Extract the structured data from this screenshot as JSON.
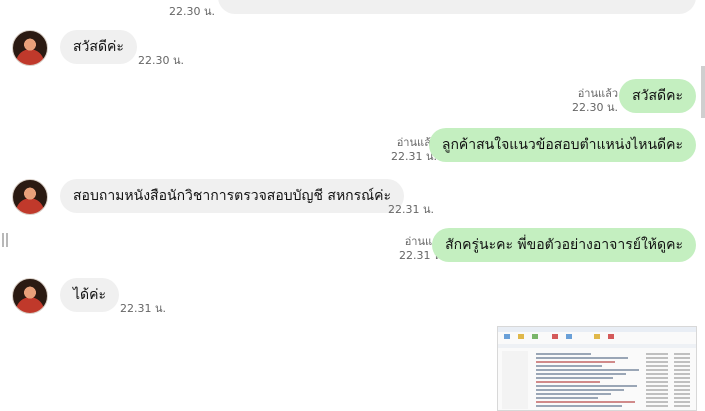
{
  "conversation": {
    "partial_top": {
      "time": "22.30 น."
    },
    "messages": [
      {
        "sender": "contact",
        "text": "สวัสดีค่ะ",
        "time": "22.30 น."
      },
      {
        "sender": "me",
        "text": "สวัสดีคะ",
        "read": "อ่านแล้ว",
        "time": "22.30 น."
      },
      {
        "sender": "me",
        "text": "ลูกค้าสนใจแนวข้อสอบตำแหน่งไหนดีคะ",
        "read": "อ่านแล้ว",
        "time": "22.31 น."
      },
      {
        "sender": "contact",
        "text": "สอบถามหนังสือนักวิชาการตรวจสอบบัญชี สหกรณ์ค่ะ",
        "time": "22.31 น."
      },
      {
        "sender": "me",
        "text": "สักครู่นะคะ พี่ขอตัวอย่างอาจารย์ให้ดูคะ",
        "read": "อ่านแล้ว",
        "time": "22.31 น."
      },
      {
        "sender": "contact",
        "text": "ได้ค่ะ",
        "time": "22.31 น."
      }
    ],
    "image_attachment": {
      "icon": "file-explorer-screenshot-icon"
    }
  },
  "colors": {
    "incoming_bubble": "#f0f0f0",
    "outgoing_bubble": "#c4efc0"
  }
}
